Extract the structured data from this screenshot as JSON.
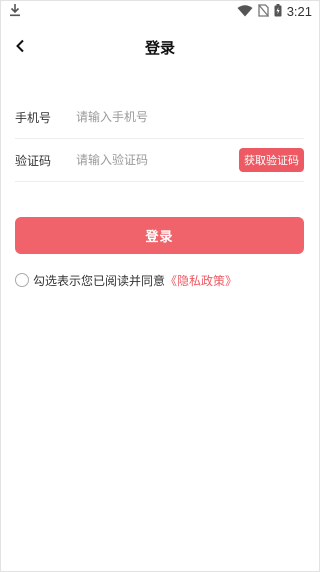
{
  "status_bar": {
    "time": "3:21",
    "icons": [
      "download-icon",
      "wifi-icon",
      "no-sim-icon",
      "battery-charging-icon"
    ]
  },
  "header": {
    "back_icon": "chevron-left-icon",
    "title": "登录"
  },
  "form": {
    "phone": {
      "label": "手机号",
      "placeholder": "请输入手机号",
      "value": ""
    },
    "code": {
      "label": "验证码",
      "placeholder": "请输入验证码",
      "value": "",
      "button_label": "获取验证码"
    }
  },
  "login_button": {
    "label": "登录"
  },
  "agreement": {
    "text": "勾选表示您已阅读并同意",
    "link_text": "《隐私政策》",
    "checked": false
  },
  "colors": {
    "accent": "#f0636a",
    "link": "#ee5a63",
    "divider": "#eeeeee"
  }
}
